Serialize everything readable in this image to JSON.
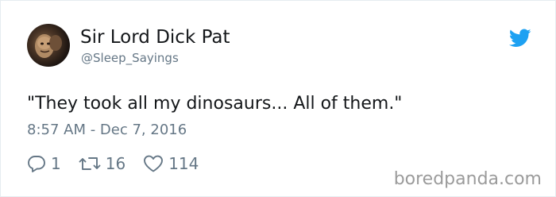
{
  "tweet": {
    "display_name": "Sir Lord Dick Pat",
    "handle": "@Sleep_Sayings",
    "text": "\"They took all my dinosaurs... All of them.\"",
    "timestamp": "8:57 AM - Dec 7, 2016",
    "replies": "1",
    "retweets": "16",
    "likes": "114"
  },
  "icons": {
    "platform": "twitter-bird-icon",
    "reply": "reply-icon",
    "retweet": "retweet-icon",
    "like": "heart-icon"
  },
  "colors": {
    "brand": "#1da1f2",
    "text": "#14171a",
    "muted": "#657786",
    "watermark": "#9b9b9b"
  },
  "watermark": "boredpanda.com"
}
